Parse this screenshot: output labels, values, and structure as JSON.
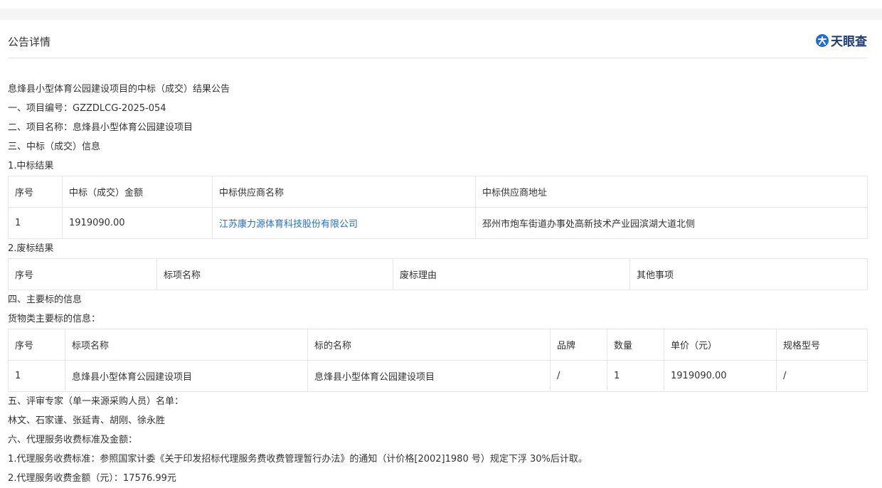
{
  "header": {
    "title": "公告详情",
    "logo_text": "天眼查"
  },
  "content": {
    "notice_title": "息烽县小型体育公园建设项目的中标（成交）结果公告",
    "project_no": "一、项目编号：GZZDLCG-2025-054",
    "project_name": "二、项目名称：息烽县小型体育公园建设项目",
    "section3": "三、中标（成交）信息",
    "sub1": "1.中标结果",
    "win_table": {
      "headers": [
        "序号",
        "中标（成交）金额",
        "中标供应商名称",
        "中标供应商地址"
      ],
      "rows": [
        [
          "1",
          "1919090.00",
          "江苏康力源体育科技股份有限公司",
          "邳州市炮车街道办事处高新技术产业园滨湖大道北侧"
        ]
      ]
    },
    "sub2": "2.废标结果",
    "fail_table": {
      "headers": [
        "序号",
        "标项名称",
        "废标理由",
        "其他事项"
      ]
    },
    "section4": "四、主要标的信息",
    "goods_label": "货物类主要标的信息：",
    "goods_table": {
      "headers": [
        "序号",
        "标项名称",
        "标的名称",
        "品牌",
        "数量",
        "单价（元）",
        "规格型号"
      ],
      "rows": [
        [
          "1",
          "息烽县小型体育公园建设项目",
          "息烽县小型体育公园建设项目",
          "/",
          "1",
          "1919090.00",
          "/"
        ]
      ]
    },
    "section5": "五、评审专家（单一来源采购人员）名单：",
    "experts": "林文、石家谨、张延青、胡刚、徐永胜",
    "section6": "六、代理服务收费标准及金额：",
    "fee_standard": "1.代理服务收费标准：参照国家计委《关于印发招标代理服务费收费管理暂行办法》的通知（计价格[2002]1980 号）规定下浮 30%后计取。",
    "fee_amount": "2.代理服务收费金额（元）：17576.99元"
  },
  "colors": {
    "link": "#1f6fd6",
    "logo": "#1f3d73",
    "border": "#e6e6e6"
  }
}
